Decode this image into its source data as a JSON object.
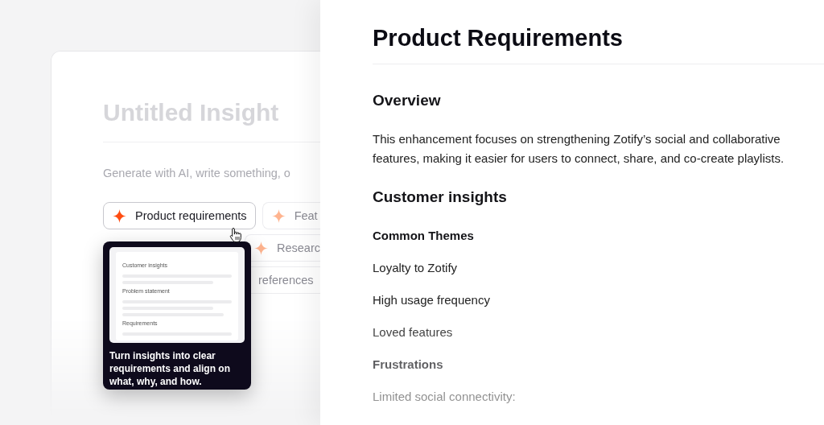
{
  "editor": {
    "title": "Untitled Insight",
    "placeholder": "Generate with AI, write something, o",
    "template_rows": [
      [
        {
          "label": "Product requirements",
          "star": true,
          "hovered": true
        },
        {
          "label": "Feat",
          "star": true,
          "hovered": false
        }
      ],
      [
        {
          "label": "Researc",
          "star": true,
          "hovered": false
        }
      ],
      [
        {
          "label": "references",
          "star": false,
          "hovered": false
        }
      ]
    ]
  },
  "tooltip": {
    "preview": [
      {
        "heading": "Customer insights"
      },
      {
        "heading": "Problem statement"
      },
      {
        "heading": "Requirements"
      }
    ],
    "text": "Turn insights into clear requirements and align on what, why, and how."
  },
  "document": {
    "title": "Product Requirements",
    "blocks": [
      {
        "kind": "heading",
        "text": "Overview"
      },
      {
        "kind": "paragraph",
        "text": "This enhancement focuses on strengthening Zotify’s social and collaborative features, making it easier for users to connect, share, and co-create playlists."
      },
      {
        "kind": "heading",
        "text": "Customer insights"
      },
      {
        "kind": "subheading",
        "text": "Common Themes"
      },
      {
        "kind": "item",
        "text": "Loyalty to Zotify"
      },
      {
        "kind": "item",
        "text": "High usage frequency"
      },
      {
        "kind": "item",
        "text": "Loved features"
      },
      {
        "kind": "subheading",
        "text": "Frustrations"
      },
      {
        "kind": "item",
        "text": "Limited social connectivity:"
      }
    ]
  }
}
